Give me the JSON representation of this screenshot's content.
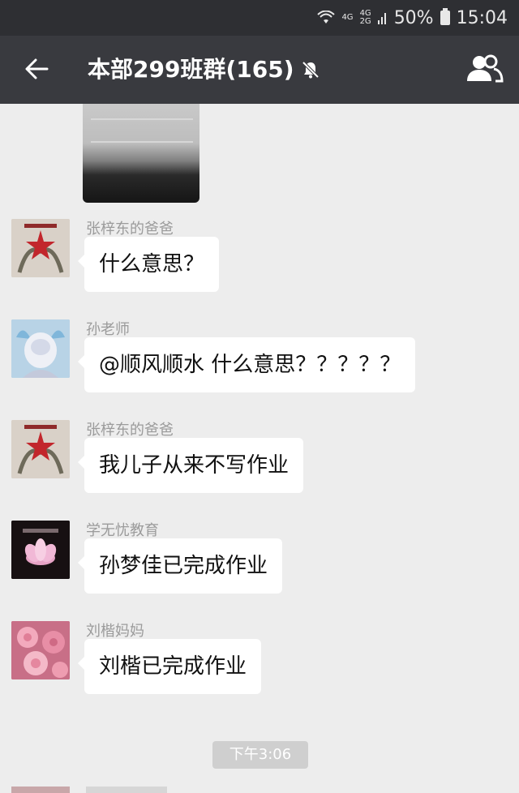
{
  "status_bar": {
    "network": "4G",
    "network2_top": "4G",
    "network2_bottom": "2G",
    "battery": "50%",
    "time": "15:04"
  },
  "header": {
    "title": "本部299班群(165)"
  },
  "messages": [
    {
      "sender": "张梓东的爸爸",
      "text": "什么意思？"
    },
    {
      "sender": "孙老师",
      "text": "@顺风顺水 什么意思？？？？？"
    },
    {
      "sender": "张梓东的爸爸",
      "text": "我儿子从来不写作业"
    },
    {
      "sender": "学无忧教育",
      "text": "孙梦佳已完成作业"
    },
    {
      "sender": "刘楷妈妈",
      "text": "刘楷已完成作业"
    }
  ],
  "timestamp": "下午3:06",
  "icons": {
    "back": "back-arrow-icon",
    "mute": "mute-bell-icon",
    "members": "group-members-icon",
    "wifi": "wifi-icon",
    "signal": "signal-icon",
    "battery": "battery-icon"
  }
}
